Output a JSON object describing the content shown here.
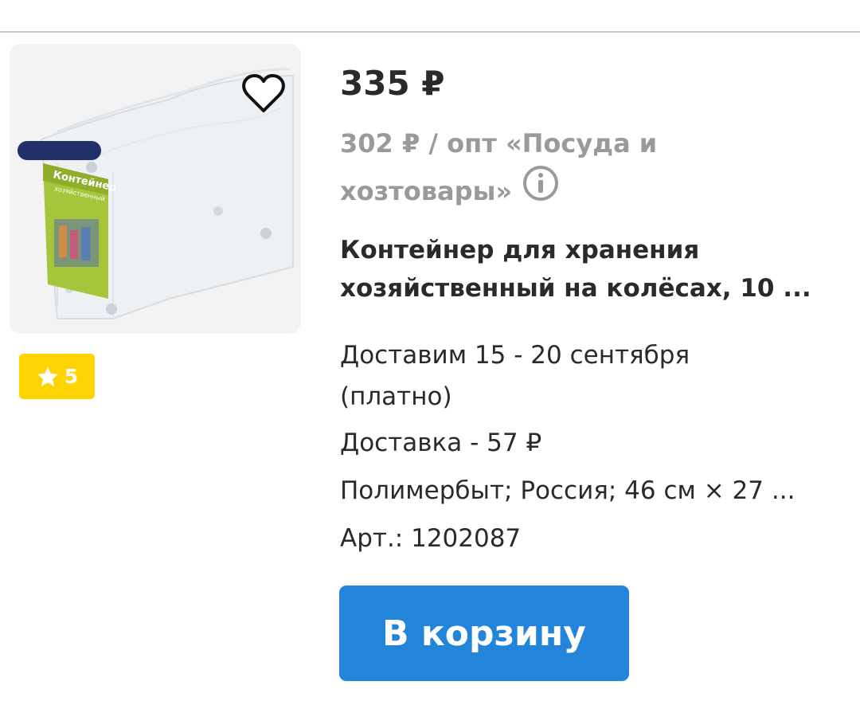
{
  "product": {
    "price": "335 ₽",
    "wholesale_line1": "302 ₽ / опт «Посуда и",
    "wholesale_line2": "хозтовары»",
    "title_line1": "Контейнер для хранения",
    "title_line2": "хозяйственный на колёсах, 10 ...",
    "delivery_line1": "Доставим 15 - 20 сентября",
    "delivery_line2": "(платно)",
    "delivery_price": "Доставка - 57 ₽",
    "specs": "Полимербыт; Россия; 46 см × 27 ...",
    "article": "Арт.: 1202087",
    "rating": "5",
    "image_label": "Контейнер",
    "image_sublabel": "хозяйственный"
  },
  "actions": {
    "cart_label": "В корзину"
  },
  "icons": {
    "favorite": "heart-icon",
    "info": "info-icon",
    "rating": "star-icon"
  },
  "colors": {
    "accent": "#2385d9",
    "rating_badge": "#ffd400",
    "muted_text": "#9a9a9a",
    "text": "#2a2a2a"
  }
}
